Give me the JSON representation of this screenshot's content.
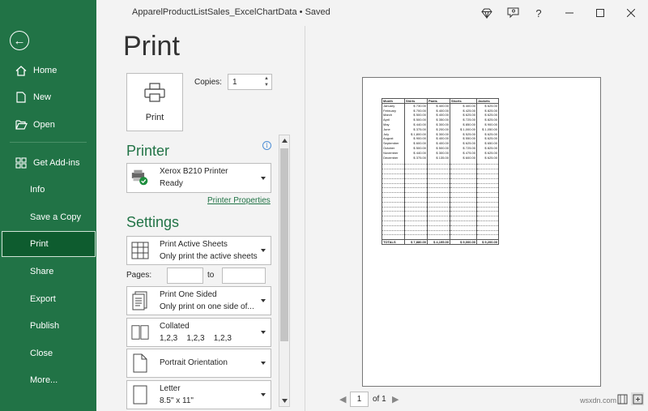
{
  "title_bar": {
    "doc_title": "ApparelProductListSales_ExcelChartData • Saved",
    "help": "?"
  },
  "sidebar": {
    "items": [
      {
        "label": "Home"
      },
      {
        "label": "New"
      },
      {
        "label": "Open"
      },
      {
        "label": "Get Add-ins"
      },
      {
        "label": "Info"
      },
      {
        "label": "Save a Copy"
      },
      {
        "label": "Print"
      },
      {
        "label": "Share"
      },
      {
        "label": "Export"
      },
      {
        "label": "Publish"
      },
      {
        "label": "Close"
      },
      {
        "label": "More..."
      }
    ],
    "active": "Print"
  },
  "print": {
    "heading": "Print",
    "button_label": "Print",
    "copies_label": "Copies:",
    "copies_value": "1"
  },
  "printer": {
    "heading": "Printer",
    "name": "Xerox B210 Printer",
    "status": "Ready",
    "properties_link": "Printer Properties"
  },
  "settings": {
    "heading": "Settings",
    "scope": {
      "title": "Print Active Sheets",
      "desc": "Only print the active sheets"
    },
    "pages_label": "Pages:",
    "to_label": "to",
    "sided": {
      "title": "Print One Sided",
      "desc": "Only print on one side of..."
    },
    "collation": {
      "title": "Collated",
      "desc": "1,2,3    1,2,3    1,2,3"
    },
    "orientation": {
      "title": "Portrait Orientation"
    },
    "paper": {
      "title": "Letter",
      "desc": "8.5\" x 11\""
    }
  },
  "preview": {
    "headers": [
      "Month",
      "Shirts",
      "Pants",
      "Shorts",
      "Jackets"
    ],
    "rows": [
      [
        "January",
        "$  730.00",
        "$  400.00",
        "$  400.00",
        "$  625.00"
      ],
      [
        "February",
        "$  700.00",
        "$  400.00",
        "$  425.00",
        "$  825.00"
      ],
      [
        "March",
        "$  500.00",
        "$  400.00",
        "$  625.00",
        "$  625.00"
      ],
      [
        "April",
        "$  500.00",
        "$  350.00",
        "$  725.00",
        "$  825.00"
      ],
      [
        "May",
        "$  440.00",
        "$  300.00",
        "$  850.00",
        "$  900.00"
      ],
      [
        "June",
        "$  375.00",
        "$  200.00",
        "$ 1,000.00",
        "$ 1,050.00"
      ],
      [
        "July",
        "$ 1,800.00",
        "$  300.00",
        "$  525.00",
        "$  625.00"
      ],
      [
        "August",
        "$  900.00",
        "$  400.00",
        "$  550.00",
        "$  625.00"
      ],
      [
        "September",
        "$  600.00",
        "$  400.00",
        "$  625.00",
        "$  650.00"
      ],
      [
        "October",
        "$  500.00",
        "$  500.00",
        "$  725.00",
        "$  825.00"
      ],
      [
        "November",
        "$  440.00",
        "$  300.00",
        "$  475.00",
        "$  625.00"
      ],
      [
        "December",
        "$  375.00",
        "$  135.00",
        "$  600.00",
        "$  625.00"
      ]
    ],
    "blank_rows": 17,
    "totals": [
      "TOTALS",
      "$ 7,880.00",
      "$ 4,195.00",
      "$ 9,000.00",
      "$ 9,200.00"
    ],
    "page_current": "1",
    "page_of": "of 1"
  },
  "watermark": "wsxdn.com",
  "colors": {
    "accent": "#217346",
    "active_nav": "#0e5c2f"
  },
  "icons": [
    "back-arrow-icon",
    "home-icon",
    "new-file-icon",
    "open-folder-icon",
    "add-ins-icon",
    "printer-icon",
    "info-icon",
    "diamond-icon",
    "coauthoring-icon",
    "minimize-icon",
    "maximize-icon",
    "close-icon"
  ]
}
